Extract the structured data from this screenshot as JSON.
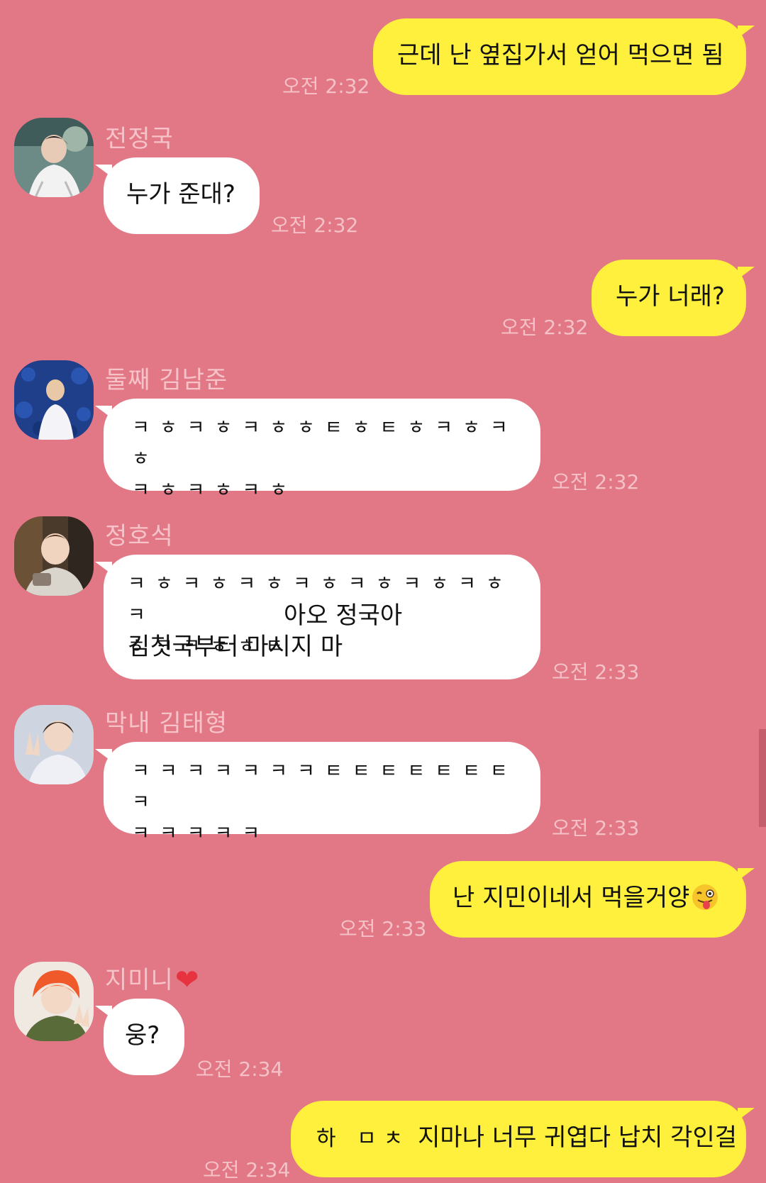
{
  "messages": [
    {
      "text": "근데 난 옆집가서 얻어 먹으면 됨",
      "time": "오전 2:32"
    },
    {
      "sender": "전정국",
      "text": "누가 준대?",
      "time": "오전 2:32"
    },
    {
      "text": "누가 너래?",
      "time": "오전 2:32"
    },
    {
      "sender": "둘째 김남준",
      "text": "ㅋㅎㅋㅎㅋㅎㅎㅌㅎㅌㅎㅋㅎㅋㅎ\nㅋㅎㅋㅎㅋㅎ",
      "time": "오전 2:32"
    },
    {
      "sender": "정호석",
      "text_kk": "ㅋㅎㅋㅎㅋㅎㅋㅎㅋㅎㅋㅎㅋㅎㅋ\nㅎㅋㅋㅎㅎㅌ",
      "text": "아오 정국아\n김칫국부터 마시지 마",
      "time": "오전 2:33"
    },
    {
      "sender": "막내 김태형",
      "text": "ㅋㅋㅋㅋㅋㅋㅋㅌㅌㅌㅌㅌㅌㅌㅋ\nㅋㅋㅋㅋㅋ",
      "time": "오전 2:33"
    },
    {
      "text": "난 지민이네서 먹을거양",
      "emoji": "winking-tongue-emoji",
      "time": "오전 2:33"
    },
    {
      "sender": "지미니",
      "sender_icon": "heart-icon",
      "text": "웅?",
      "time": "오전 2:34"
    },
    {
      "text_kk": "하 ㅁㅊ",
      "text": "지마나 너무 귀엽다 납치 각인걸",
      "time": "오전 2:34"
    }
  ],
  "colors": {
    "background": "#e27785",
    "incoming_bubble": "#ffffff",
    "outgoing_bubble": "#fef03c",
    "name": "#f6c3c9",
    "time": "#f4c1c7"
  }
}
